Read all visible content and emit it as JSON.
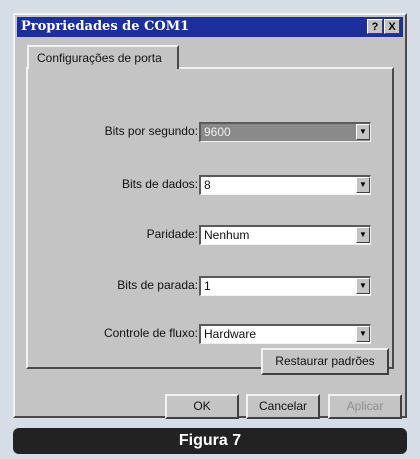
{
  "window": {
    "title": "Propriedades de COM1",
    "help_label": "?",
    "close_label": "X"
  },
  "tab": {
    "label": "Configurações de porta"
  },
  "fields": [
    {
      "label": "Bits por segundo:",
      "value": "9600"
    },
    {
      "label": "Bits de dados:",
      "value": "8"
    },
    {
      "label": "Paridade:",
      "value": "Nenhum"
    },
    {
      "label": "Bits de parada:",
      "value": "1"
    },
    {
      "label": "Controle de fluxo:",
      "value": "Hardware"
    }
  ],
  "buttons": {
    "restore": "Restaurar padrões",
    "ok": "OK",
    "cancel": "Cancelar",
    "apply": "Aplicar"
  },
  "caption": "Figura 7",
  "colors": {
    "titlebar": "#1c2f9a",
    "face": "#c4c4c4",
    "page_background": "#d6dde6",
    "caption_background": "#222222"
  }
}
